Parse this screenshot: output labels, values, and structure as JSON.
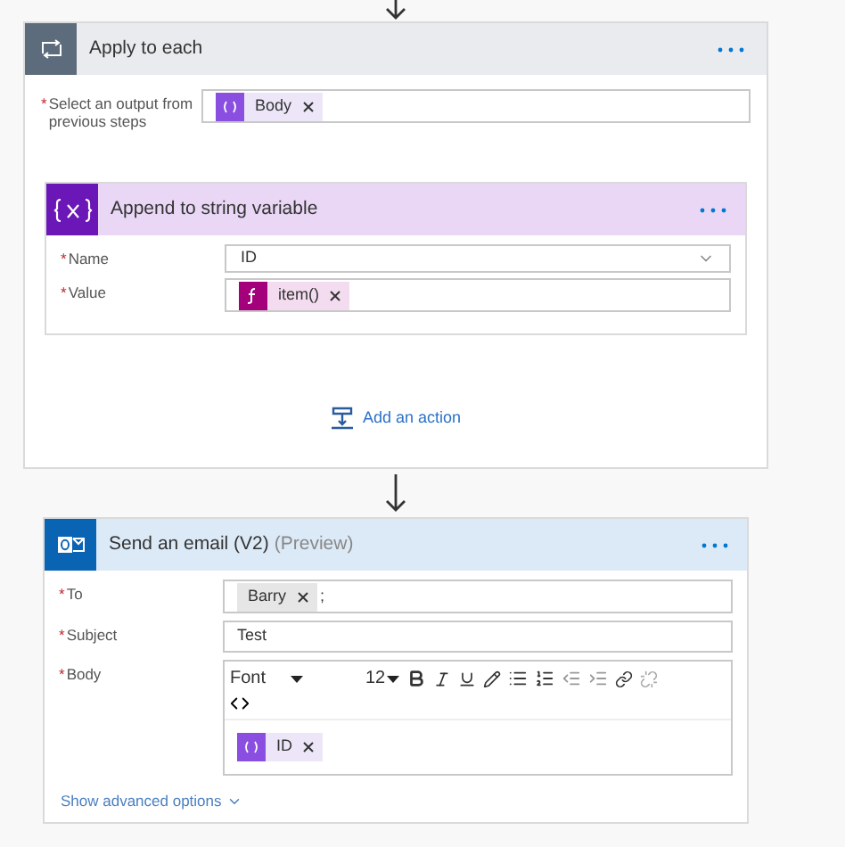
{
  "apply_to_each": {
    "title": "Apply to each",
    "field": {
      "required_mark": "*",
      "label": "Select an output from previous steps",
      "tokens": [
        {
          "text": "Body",
          "kind": "variable"
        }
      ]
    },
    "append_action": {
      "title": "Append to string variable",
      "fields": [
        {
          "required_mark": "*",
          "label": "Name",
          "kind": "dropdown",
          "value": "ID"
        },
        {
          "required_mark": "*",
          "label": "Value",
          "kind": "tokens",
          "tokens": [
            {
              "text": "item()",
              "kind": "expression"
            }
          ]
        }
      ]
    },
    "add_action": "Add an action"
  },
  "send_email": {
    "title": "Send an email (V2)",
    "tag": "(Preview)",
    "fields": [
      {
        "required_mark": "*",
        "label": "To",
        "kind": "tokens",
        "tokens": [
          {
            "text": "Barry",
            "kind": "plain"
          }
        ],
        "suffix": ";"
      },
      {
        "required_mark": "*",
        "label": "Subject",
        "kind": "text",
        "value": "Test"
      },
      {
        "required_mark": "*",
        "label": "Body",
        "kind": "rich",
        "font": "Font",
        "size": "12",
        "tokens": [
          {
            "text": "ID",
            "kind": "variable"
          }
        ]
      }
    ],
    "show_advanced": "Show advanced options"
  }
}
